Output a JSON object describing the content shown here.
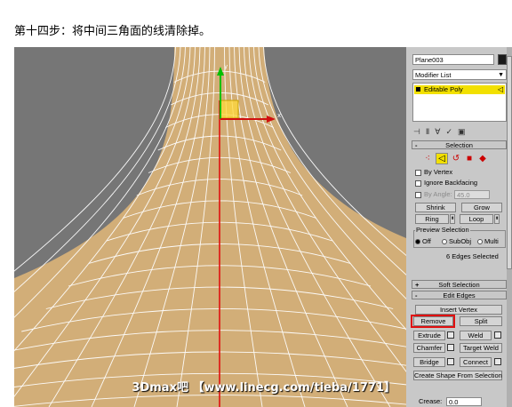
{
  "caption": "第十四步：将中间三角面的线清除掉。",
  "watermark": "3Dmax吧 【www.linecg.com/tieba/1771】",
  "panel": {
    "object_name": "Plane003",
    "object_color": "#1a1a1a",
    "modifier_list": "Modifier List",
    "stack_item": "Editable Poly",
    "toolbar_icons": [
      "pin-stack-icon",
      "show-end-result-icon",
      "make-unique-icon",
      "remove-modifier-icon",
      "configure-modifier-sets-icon"
    ],
    "selection": {
      "header": "Selection",
      "sub_objects": [
        "vertex",
        "edge",
        "border",
        "polygon",
        "element"
      ],
      "active_sub_object": "edge",
      "by_vertex": "By Vertex",
      "ignore_backfacing": "Ignore Backfacing",
      "by_angle": "By Angle:",
      "by_angle_value": "45.0",
      "shrink": "Shrink",
      "grow": "Grow",
      "ring": "Ring",
      "loop": "Loop",
      "preview_label": "Preview Selection",
      "preview_options": [
        "Off",
        "SubObj",
        "Multi"
      ],
      "preview_selected": "Off",
      "status": "6 Edges Selected"
    },
    "soft_selection": {
      "header": "Soft Selection",
      "sign": "+"
    },
    "edit_edges": {
      "header": "Edit Edges",
      "sign": "-",
      "insert_vertex": "Insert Vertex",
      "remove": "Remove",
      "split": "Split",
      "extrude": "Extrude",
      "weld": "Weld",
      "chamfer": "Chamfer",
      "target_weld": "Target Weld",
      "bridge": "Bridge",
      "connect": "Connect",
      "create_shape": "Create Shape From Selection",
      "crease_label": "Crease:",
      "crease_value": "0.0"
    }
  },
  "colors": {
    "viewport_bg": "#767676",
    "mesh_fill": "#d2ae78",
    "wire": "#ffffff",
    "selected_edges": "#e01010",
    "highlight_box": "#e01010",
    "stack_highlight": "#f2e000"
  }
}
